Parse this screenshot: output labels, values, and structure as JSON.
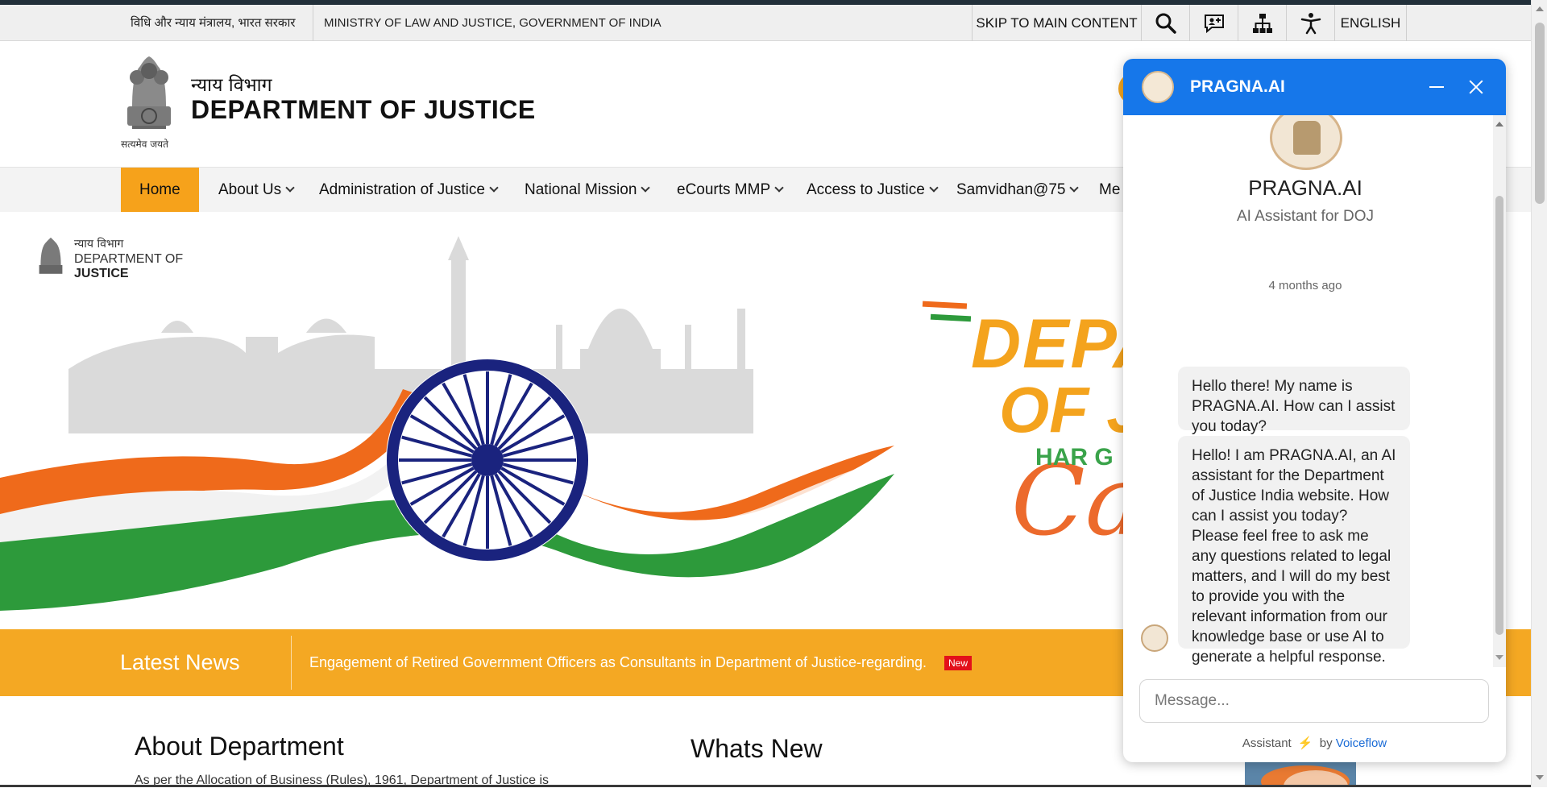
{
  "util": {
    "hindi_title": "विधि और न्याय मंत्रालय, भारत सरकार",
    "english_title": "MINISTRY OF LAW AND JUSTICE, GOVERNMENT OF INDIA",
    "skip_label": "SKIP TO MAIN CONTENT",
    "language": "ENGLISH",
    "icons": [
      "search-icon",
      "feedback-icon",
      "sitemap-icon",
      "accessibility-icon"
    ]
  },
  "header": {
    "dept_hindi": "न्याय विभाग",
    "dept_english": "DEPARTMENT OF JUSTICE",
    "emblem_motto": "सत्यमेव जयते"
  },
  "nav": {
    "items": [
      {
        "label": "Home",
        "active": true
      },
      {
        "label": "About Us"
      },
      {
        "label": "Administration of Justice"
      },
      {
        "label": "National Mission"
      },
      {
        "label": "eCourts MMP"
      },
      {
        "label": "Access to Justice"
      },
      {
        "label": "Samvidhan@75"
      },
      {
        "label": "Me"
      }
    ]
  },
  "banner": {
    "logo_hindi": "न्याय विभाग",
    "logo_line1": "DEPARTMENT OF",
    "logo_line2": "JUSTICE",
    "headline1": "DEPA",
    "headline2": "OF J",
    "tagline": "HAR G",
    "script": "Ca"
  },
  "news": {
    "label": "Latest News",
    "text": "Engagement of Retired Government Officers as Consultants in Department of Justice-regarding.",
    "badge": "New"
  },
  "sections": {
    "about_title": "About Department",
    "whats_new_title": "Whats New",
    "about_text": "As per the Allocation of Business (Rules), 1961, Department of Justice is"
  },
  "chat": {
    "title": "PRAGNA.AI",
    "bot_name": "PRAGNA.AI",
    "bot_subtitle": "AI Assistant for DOJ",
    "timestamp": "4 months ago",
    "messages": [
      "Hello there! My name is PRAGNA.AI. How can I assist you today?",
      "Hello! I am PRAGNA.AI, an AI assistant for the Department of Justice India website. How can I assist you today? Please feel free to ask me any questions related to legal matters, and I will do my best to provide you with the relevant information from our knowledge base or use AI to generate a helpful response."
    ],
    "input_placeholder": "Message...",
    "footer_prefix": "Assistant",
    "footer_by": "by",
    "footer_brand": "Voiceflow",
    "brand_color": "#1677ea"
  },
  "colors": {
    "accent_orange": "#f6a21b",
    "news_bar": "#f4a823",
    "badge_red": "#e3101a"
  }
}
